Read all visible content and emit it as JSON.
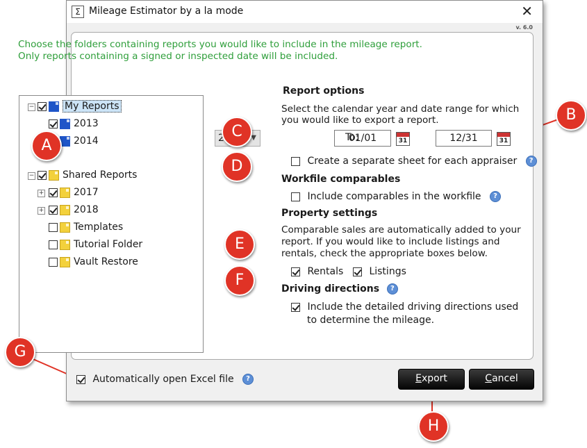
{
  "window": {
    "title": "Mileage Estimator by a la mode",
    "version": "v. 6.0",
    "close_glyph": "✕",
    "icon_glyph": "Σ"
  },
  "intro": {
    "line1": "Choose the folders containing reports you would like to include in the mileage report.",
    "line2": "Only reports containing a signed or inspected date will be included."
  },
  "tree": {
    "my_reports": {
      "label": "My Reports",
      "checked": true,
      "expanded": true,
      "selected": true
    },
    "my_children": [
      {
        "label": "2013",
        "checked": true
      },
      {
        "label": "2014",
        "checked": true
      }
    ],
    "shared_reports": {
      "label": "Shared Reports",
      "checked": true,
      "expanded": true
    },
    "shared_children": [
      {
        "label": "2017",
        "checked": true,
        "expandable": true
      },
      {
        "label": "2018",
        "checked": true,
        "expandable": true
      },
      {
        "label": "Templates",
        "checked": false
      },
      {
        "label": "Tutorial Folder",
        "checked": false
      },
      {
        "label": "Vault Restore",
        "checked": false
      }
    ]
  },
  "report_options": {
    "heading": "Report options",
    "desc1": "Select the calendar year and date range for which",
    "desc2": "you would like to export a report.",
    "year": "2017",
    "from_date": "01/01",
    "to_label": "To:",
    "to_date": "12/31",
    "calendar_day": "31",
    "separate_sheet_label": "Create a separate sheet for each appraiser",
    "separate_sheet_checked": false
  },
  "workfile": {
    "heading": "Workfile comparables",
    "include_label": "Include comparables in the workfile",
    "include_checked": false
  },
  "property": {
    "heading": "Property settings",
    "desc1": "Comparable sales are automatically added to your",
    "desc2": "report.  If you would like to include listings and",
    "desc3": "rentals, check the appropriate boxes below.",
    "rentals_label": "Rentals",
    "rentals_checked": true,
    "listings_label": "Listings",
    "listings_checked": true
  },
  "driving": {
    "heading": "Driving directions",
    "include_label1": "Include the detailed driving directions used",
    "include_label2": "to determine the mileage.",
    "include_checked": true
  },
  "footer": {
    "auto_open_label": "Automatically open Excel file",
    "auto_open_checked": true,
    "export_label": "Export",
    "cancel_label": "Cancel"
  },
  "help_glyph": "?",
  "callouts": [
    "A",
    "B",
    "C",
    "D",
    "E",
    "F",
    "G",
    "H"
  ],
  "colors": {
    "intro_text": "#2e9e3a",
    "callout": "#e03326",
    "button": "#111111",
    "folder_personal": "#1f55c8",
    "folder_shared": "#f3d13c"
  }
}
